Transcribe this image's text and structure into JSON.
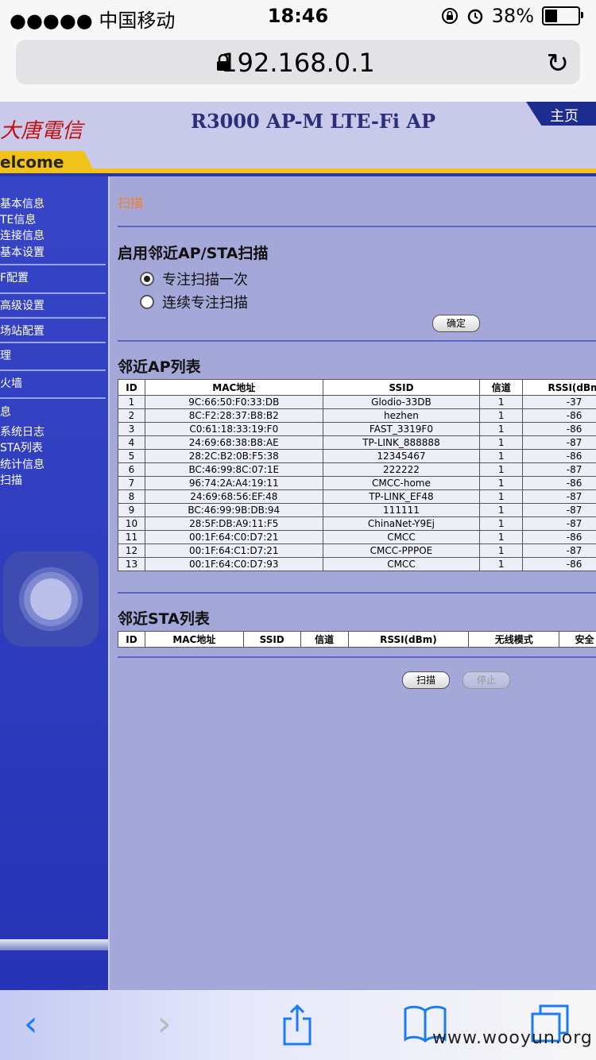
{
  "status_bar": {
    "carrier": "●●●●● 中国移动",
    "time": "18:46",
    "battery": "38%",
    "battery_level": 0.38
  },
  "address_bar": {
    "url": "192.168.0.1"
  },
  "banner": {
    "logo_text": "大唐電信",
    "product": "R3000 AP-M LTE-Fi AP",
    "home_tab": "主页",
    "welcome": "elcome"
  },
  "sidebar": {
    "items": [
      {
        "label": "基本信息"
      },
      {
        "label": "TE信息"
      },
      {
        "label": "连接信息"
      },
      {
        "label": "基本设置"
      },
      {
        "label": "F配置"
      },
      {
        "label": "高级设置"
      },
      {
        "label": "场站配置"
      },
      {
        "label": "理"
      },
      {
        "label": "火墙"
      },
      {
        "label": "息"
      },
      {
        "label": "系统日志"
      },
      {
        "label": "STA列表"
      },
      {
        "label": "统计信息"
      },
      {
        "label": "扫描"
      }
    ]
  },
  "main": {
    "page_title": "扫描",
    "scan_section": {
      "title": "启用邻近AP/STA扫描",
      "options": [
        {
          "label": "专注扫描一次",
          "checked": true
        },
        {
          "label": "连续专注扫描",
          "checked": false
        }
      ],
      "confirm_button": "确定"
    },
    "ap_section": {
      "title": "邻近AP列表",
      "headers": [
        "ID",
        "MAC地址",
        "SSID",
        "信道",
        "RSSI(dBm"
      ],
      "rows": [
        [
          "1",
          "9C:66:50:F0:33:DB",
          "Glodio-33DB",
          "1",
          "-37"
        ],
        [
          "2",
          "8C:F2:28:37:B8:B2",
          "hezhen",
          "1",
          "-86"
        ],
        [
          "3",
          "C0:61:18:33:19:F0",
          "FAST_3319F0",
          "1",
          "-86"
        ],
        [
          "4",
          "24:69:68:38:B8:AE",
          "TP-LINK_888888",
          "1",
          "-87"
        ],
        [
          "5",
          "28:2C:B2:0B:F5:38",
          "12345467",
          "1",
          "-86"
        ],
        [
          "6",
          "BC:46:99:8C:07:1E",
          "222222",
          "1",
          "-87"
        ],
        [
          "7",
          "96:74:2A:A4:19:11",
          "CMCC-home",
          "1",
          "-86"
        ],
        [
          "8",
          "24:69:68:56:EF:48",
          "TP-LINK_EF48",
          "1",
          "-87"
        ],
        [
          "9",
          "BC:46:99:9B:DB:94",
          "111111",
          "1",
          "-87"
        ],
        [
          "10",
          "28:5F:DB:A9:11:F5",
          "ChinaNet-Y9Ej",
          "1",
          "-87"
        ],
        [
          "11",
          "00:1F:64:C0:D7:21",
          "CMCC",
          "1",
          "-86"
        ],
        [
          "12",
          "00:1F:64:C1:D7:21",
          "CMCC-PPPOE",
          "1",
          "-87"
        ],
        [
          "13",
          "00:1F:64:C0:D7:93",
          "CMCC",
          "1",
          "-86"
        ]
      ]
    },
    "sta_section": {
      "title": "邻近STA列表",
      "headers": [
        "ID",
        "MAC地址",
        "SSID",
        "信道",
        "RSSI(dBm)",
        "无线模式",
        "安全"
      ]
    },
    "scan_button": "扫描",
    "stop_button": "停止"
  },
  "toolbar": {
    "back": "‹",
    "forward": "›"
  },
  "watermark": "www.wooyun.org"
}
